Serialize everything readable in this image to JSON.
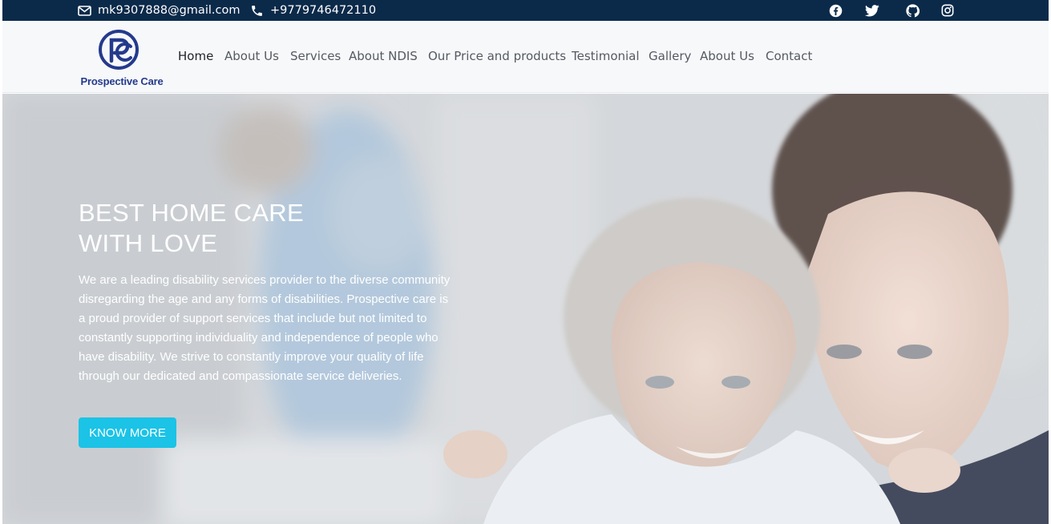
{
  "topbar": {
    "email": "mk9307888@gmail.com",
    "phone": "+9779746472110",
    "social_icons": [
      "facebook-icon",
      "twitter-icon",
      "github-icon",
      "instagram-icon"
    ],
    "background_color": "#0b2a4a"
  },
  "brand": {
    "name": "Prospective Care",
    "color": "#243a8c"
  },
  "nav": {
    "items": [
      {
        "label": "Home"
      },
      {
        "label": "About Us"
      },
      {
        "label": "Services"
      },
      {
        "label": "About NDIS"
      },
      {
        "label": "Our Price and products"
      },
      {
        "label": "Testimonial"
      },
      {
        "label": "Gallery"
      },
      {
        "label": "About Us"
      },
      {
        "label": "Contact"
      }
    ],
    "active_index": 0
  },
  "hero": {
    "title_line1": "BEST HOME CARE",
    "title_line2": "WITH LOVE",
    "text": "We are a leading disability services provider to the diverse community disregarding the age and any forms of disabilities. Prospective care is a proud provider of support services that include but not limited to constantly supporting individuality and independence of people who have disability. We strive to constantly improve your quality of life through our dedicated and compassionate service deliveries.",
    "button_label": "KNOW MORE",
    "button_color": "#1bc3e6"
  }
}
